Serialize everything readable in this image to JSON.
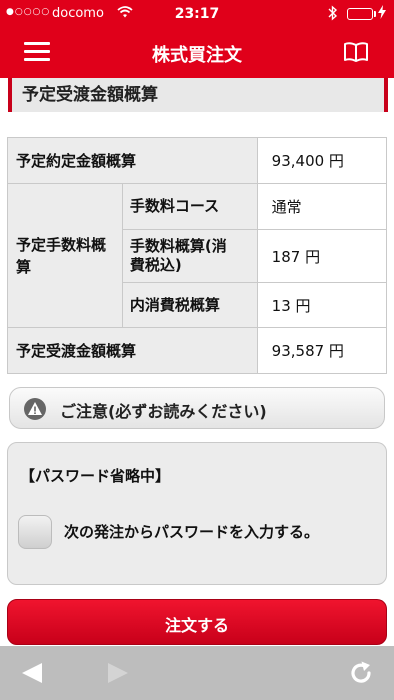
{
  "status_bar": {
    "signal": "●○○○○",
    "carrier": "docomo",
    "time": "23:17"
  },
  "nav": {
    "title": "株式買注文"
  },
  "section": {
    "title": "予定受渡金額概算"
  },
  "table": {
    "row1": {
      "label": "予定約定金額概算",
      "value": "93,400 円"
    },
    "fee_group_label": "予定手数料概算",
    "row2": {
      "sublabel": "手数料コース",
      "value": "通常"
    },
    "row3": {
      "sublabel": "手数料概算(消費税込)",
      "value": "187 円"
    },
    "row4": {
      "sublabel": "内消費税概算",
      "value": "13 円"
    },
    "row5": {
      "label": "予定受渡金額概算",
      "value": "93,587 円"
    }
  },
  "notice": {
    "label": "ご注意(必ずお読みください)"
  },
  "password": {
    "heading": "【パスワード省略中】",
    "checkbox_label": "次の発注からパスワードを入力する。"
  },
  "order_button": {
    "label": "注文する"
  },
  "colors": {
    "brand_red": "#e0001a",
    "toolbar_gray": "#bdbdbd"
  }
}
